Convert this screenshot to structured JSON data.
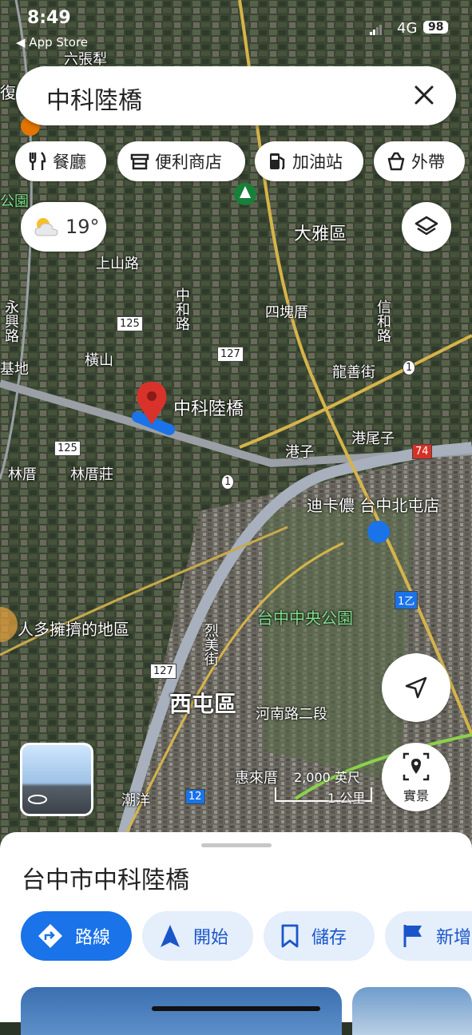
{
  "status_bar": {
    "time": "8:49",
    "back_label": "◀ App Store",
    "network": "4G",
    "battery": "98"
  },
  "search": {
    "query": "中科陸橋"
  },
  "chips": [
    {
      "label": "餐廳",
      "icon": "restaurant-icon"
    },
    {
      "label": "便利商店",
      "icon": "store-icon"
    },
    {
      "label": "加油站",
      "icon": "gas-station-icon"
    },
    {
      "label": "外帶",
      "icon": "takeout-icon"
    }
  ],
  "weather": {
    "temp": "19°",
    "icon": "partly-cloudy-icon"
  },
  "map": {
    "pin_label": "中科陸橋",
    "labels": {
      "liuzhangli": "六張犁",
      "park": "公園",
      "daya": "大雅區",
      "shangshan": "上山路",
      "zhonghe": "中和路",
      "sikuaicuo": "四塊厝",
      "xinhe": "信和路",
      "yongxing": "永興路",
      "hengshan": "橫山",
      "jidi": "基地",
      "longshan": "龍善街",
      "gangweizi": "港尾子",
      "gangzi": "港子",
      "linhu": "林厝",
      "linhuzhuang": "林厝莊",
      "costco": "迪卡儂 台中北屯店",
      "central_park": "台中中央公園",
      "crowded": "人多擁擠的地區",
      "liemei": "烈美街",
      "xitun": "西屯區",
      "henan": "河南路二段",
      "huilaicuo": "惠來厝",
      "chaoyang": "潮洋",
      "fu": "復"
    },
    "shields": {
      "r125a": "125",
      "r127": "127",
      "r125b": "125",
      "r1": "1",
      "r1b": "1",
      "r74": "74",
      "r1y": "1乙",
      "r127b": "127",
      "r12": "12"
    },
    "scale": {
      "feet": "2,000 英尺",
      "km": "1 公里"
    },
    "colors": {
      "pin": "#d9322a",
      "blue": "#1a73e8"
    }
  },
  "live_view": {
    "label": "實景"
  },
  "sheet": {
    "title": "台中市中科陸橋",
    "actions": [
      {
        "label": "路線",
        "icon": "directions-icon"
      },
      {
        "label": "開始",
        "icon": "navigation-icon"
      },
      {
        "label": "儲存",
        "icon": "bookmark-icon"
      },
      {
        "label": "新增",
        "icon": "flag-icon"
      }
    ]
  }
}
